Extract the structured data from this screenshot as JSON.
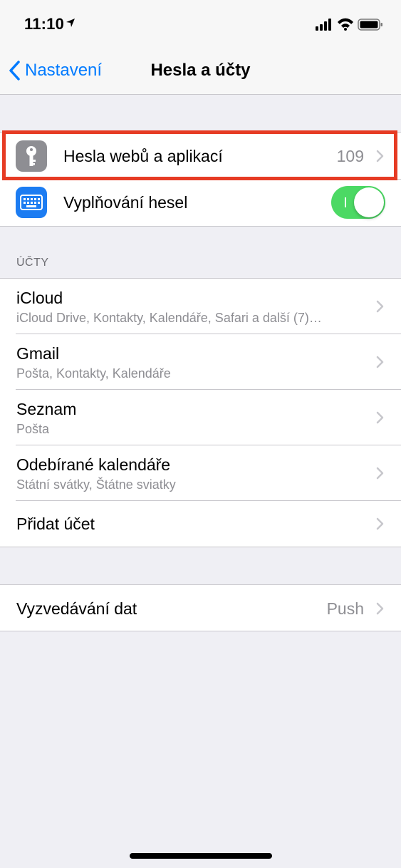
{
  "status_bar": {
    "time": "11:10"
  },
  "nav": {
    "back_label": "Nastavení",
    "title": "Hesla a účty"
  },
  "passwords_group": {
    "website_passwords": {
      "label": "Hesla webů a aplikací",
      "count": "109",
      "icon": "key-icon"
    },
    "autofill": {
      "label": "Vyplňování hesel",
      "icon": "keyboard-icon",
      "toggle_on": true
    }
  },
  "accounts": {
    "header": "ÚČTY",
    "items": [
      {
        "name": "iCloud",
        "detail": "iCloud Drive, Kontakty, Kalendáře, Safari a další (7)…"
      },
      {
        "name": "Gmail",
        "detail": "Pošta, Kontakty, Kalendáře"
      },
      {
        "name": "Seznam",
        "detail": "Pošta"
      },
      {
        "name": "Odebírané kalendáře",
        "detail": "Státní svátky, Štátne sviatky"
      }
    ],
    "add_account": "Přidat účet"
  },
  "fetch": {
    "label": "Vyzvedávání dat",
    "value": "Push"
  },
  "colors": {
    "accent": "#007aff",
    "toggle_on": "#4cd964",
    "highlight": "#e63b24",
    "key_icon_bg": "#8e8e93",
    "keyboard_icon_bg": "#1c7cf2"
  }
}
